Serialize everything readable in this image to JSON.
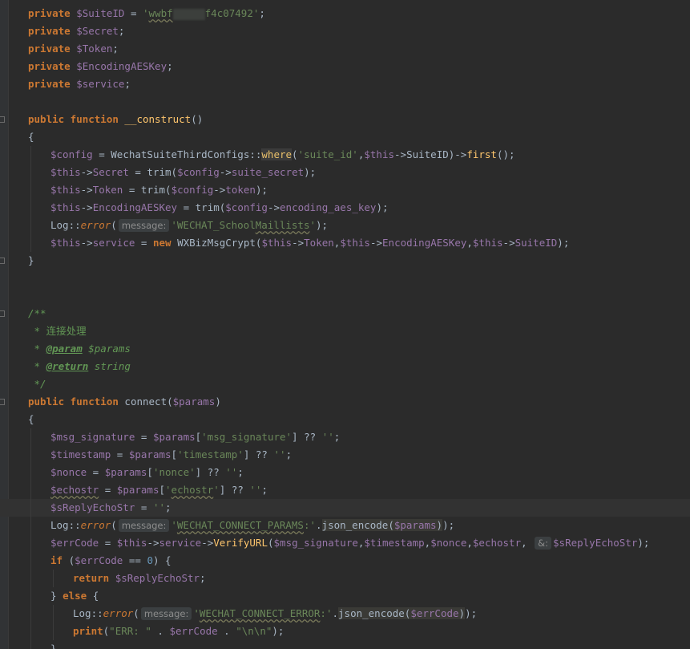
{
  "editor": {
    "lines": [
      {
        "i": 0,
        "indent": 0,
        "tokens": [
          [
            "kw",
            "private"
          ],
          [
            "pl",
            " "
          ],
          [
            "var",
            "$SuiteID"
          ],
          [
            "pl",
            " = "
          ],
          [
            "str",
            "'"
          ],
          [
            "str wavy",
            "wwbf"
          ],
          [
            "blur",
            ""
          ],
          [
            "str",
            "f4c07492"
          ],
          [
            "str",
            "'"
          ],
          [
            "op",
            ";"
          ]
        ]
      },
      {
        "i": 1,
        "indent": 0,
        "tokens": [
          [
            "kw",
            "private"
          ],
          [
            "pl",
            " "
          ],
          [
            "var",
            "$Secret"
          ],
          [
            "op",
            ";"
          ]
        ]
      },
      {
        "i": 2,
        "indent": 0,
        "tokens": [
          [
            "kw",
            "private"
          ],
          [
            "pl",
            " "
          ],
          [
            "var",
            "$Token"
          ],
          [
            "op",
            ";"
          ]
        ]
      },
      {
        "i": 3,
        "indent": 0,
        "tokens": [
          [
            "kw",
            "private"
          ],
          [
            "pl",
            " "
          ],
          [
            "var",
            "$EncodingAESKey"
          ],
          [
            "op",
            ";"
          ]
        ]
      },
      {
        "i": 4,
        "indent": 0,
        "tokens": [
          [
            "kw",
            "private"
          ],
          [
            "pl",
            " "
          ],
          [
            "var",
            "$service"
          ],
          [
            "op",
            ";"
          ]
        ]
      },
      {
        "i": 6,
        "indent": 0,
        "tokens": [
          [
            "kw",
            "public function"
          ],
          [
            "pl",
            " "
          ],
          [
            "fn",
            "__construct"
          ],
          [
            "pl",
            "()"
          ]
        ]
      },
      {
        "i": 7,
        "indent": 0,
        "tokens": [
          [
            "pl",
            "{"
          ]
        ]
      },
      {
        "i": 8,
        "indent": 1,
        "tokens": [
          [
            "var",
            "$config"
          ],
          [
            "pl",
            " = WechatSuiteThirdConfigs::"
          ],
          [
            "hl",
            "where"
          ],
          [
            "pl",
            "("
          ],
          [
            "str",
            "'suite_id'"
          ],
          [
            "pl",
            ","
          ],
          [
            "var",
            "$this"
          ],
          [
            "pl",
            "->SuiteID)->"
          ],
          [
            "fn",
            "first"
          ],
          [
            "pl",
            "();"
          ]
        ]
      },
      {
        "i": 9,
        "indent": 1,
        "tokens": [
          [
            "var",
            "$this"
          ],
          [
            "pl",
            "->"
          ],
          [
            "var",
            "Secret"
          ],
          [
            "pl",
            " = trim("
          ],
          [
            "var",
            "$config"
          ],
          [
            "pl",
            "->"
          ],
          [
            "var",
            "suite_secret"
          ],
          [
            "pl",
            ");"
          ]
        ]
      },
      {
        "i": 10,
        "indent": 1,
        "tokens": [
          [
            "var",
            "$this"
          ],
          [
            "pl",
            "->"
          ],
          [
            "var",
            "Token"
          ],
          [
            "pl",
            " = trim("
          ],
          [
            "var",
            "$config"
          ],
          [
            "pl",
            "->"
          ],
          [
            "var",
            "token"
          ],
          [
            "pl",
            ");"
          ]
        ]
      },
      {
        "i": 11,
        "indent": 1,
        "tokens": [
          [
            "var",
            "$this"
          ],
          [
            "pl",
            "->"
          ],
          [
            "var",
            "EncodingAESKey"
          ],
          [
            "pl",
            " = trim("
          ],
          [
            "var",
            "$config"
          ],
          [
            "pl",
            "->"
          ],
          [
            "var",
            "encoding_aes_key"
          ],
          [
            "pl",
            ");"
          ]
        ]
      },
      {
        "i": 12,
        "indent": 1,
        "tokens": [
          [
            "pl",
            "Log::"
          ],
          [
            "it",
            "error"
          ],
          [
            "pl",
            "("
          ],
          [
            "hint",
            "message:"
          ],
          [
            "str",
            "'WECHAT_School"
          ],
          [
            "str wavy",
            "Maillists"
          ],
          [
            "str",
            "'"
          ],
          [
            "pl",
            ");"
          ]
        ]
      },
      {
        "i": 13,
        "indent": 1,
        "tokens": [
          [
            "var",
            "$this"
          ],
          [
            "pl",
            "->"
          ],
          [
            "var",
            "service"
          ],
          [
            "pl",
            " = "
          ],
          [
            "kw",
            "new"
          ],
          [
            "pl",
            " WXBizMsgCrypt("
          ],
          [
            "var",
            "$this"
          ],
          [
            "pl",
            "->"
          ],
          [
            "var",
            "Token"
          ],
          [
            "pl",
            ","
          ],
          [
            "var",
            "$this"
          ],
          [
            "pl",
            "->"
          ],
          [
            "var",
            "EncodingAESKey"
          ],
          [
            "pl",
            ","
          ],
          [
            "var",
            "$this"
          ],
          [
            "pl",
            "->"
          ],
          [
            "var",
            "SuiteID"
          ],
          [
            "pl",
            ");"
          ]
        ]
      },
      {
        "i": 14,
        "indent": 0,
        "tokens": [
          [
            "pl",
            "}"
          ]
        ]
      },
      {
        "i": 17,
        "indent": 0,
        "tokens": [
          [
            "cmi",
            "/**"
          ]
        ]
      },
      {
        "i": 18,
        "indent": 0,
        "tokens": [
          [
            "cmi",
            " * "
          ],
          [
            "cjk",
            "连接处理"
          ]
        ]
      },
      {
        "i": 19,
        "indent": 0,
        "tokens": [
          [
            "cmi",
            " * "
          ],
          [
            "tag",
            "@param"
          ],
          [
            "cmi",
            " $params"
          ]
        ]
      },
      {
        "i": 20,
        "indent": 0,
        "tokens": [
          [
            "cmi",
            " * "
          ],
          [
            "tag",
            "@return"
          ],
          [
            "cmi",
            " string"
          ]
        ]
      },
      {
        "i": 21,
        "indent": 0,
        "tokens": [
          [
            "cmi",
            " */"
          ]
        ]
      },
      {
        "i": 22,
        "indent": 0,
        "tokens": [
          [
            "kw",
            "public function"
          ],
          [
            "pl",
            " connect("
          ],
          [
            "var",
            "$params"
          ],
          [
            "pl",
            ")"
          ]
        ]
      },
      {
        "i": 23,
        "indent": 0,
        "tokens": [
          [
            "pl",
            "{"
          ]
        ]
      },
      {
        "i": 24,
        "indent": 1,
        "tokens": [
          [
            "var",
            "$msg_signature"
          ],
          [
            "pl",
            " = "
          ],
          [
            "var",
            "$params"
          ],
          [
            "pl",
            "["
          ],
          [
            "str",
            "'msg_signature'"
          ],
          [
            "pl",
            "] ?? "
          ],
          [
            "str",
            "''"
          ],
          [
            "op",
            ";"
          ]
        ]
      },
      {
        "i": 25,
        "indent": 1,
        "tokens": [
          [
            "var",
            "$timestamp"
          ],
          [
            "pl",
            " = "
          ],
          [
            "var",
            "$params"
          ],
          [
            "pl",
            "["
          ],
          [
            "str",
            "'timestamp'"
          ],
          [
            "pl",
            "] ?? "
          ],
          [
            "str",
            "''"
          ],
          [
            "op",
            ";"
          ]
        ]
      },
      {
        "i": 26,
        "indent": 1,
        "tokens": [
          [
            "var",
            "$nonce"
          ],
          [
            "pl",
            " = "
          ],
          [
            "var",
            "$params"
          ],
          [
            "pl",
            "["
          ],
          [
            "str",
            "'nonce'"
          ],
          [
            "pl",
            "] ?? "
          ],
          [
            "str",
            "''"
          ],
          [
            "op",
            ";"
          ]
        ]
      },
      {
        "i": 27,
        "indent": 1,
        "tokens": [
          [
            "var wavy",
            "$echostr"
          ],
          [
            "pl",
            " = "
          ],
          [
            "var",
            "$params"
          ],
          [
            "pl",
            "["
          ],
          [
            "str",
            "'"
          ],
          [
            "str wavy",
            "echostr"
          ],
          [
            "str",
            "'"
          ],
          [
            "pl",
            "] ?? "
          ],
          [
            "str",
            "''"
          ],
          [
            "op",
            ";"
          ]
        ]
      },
      {
        "i": 28,
        "indent": 1,
        "current": true,
        "tokens": [
          [
            "var",
            "$sReplyEchoStr"
          ],
          [
            "pl",
            " = "
          ],
          [
            "str",
            "''"
          ],
          [
            "op",
            ";"
          ]
        ]
      },
      {
        "i": 29,
        "indent": 1,
        "tokens": [
          [
            "pl",
            "Log::"
          ],
          [
            "it",
            "error"
          ],
          [
            "pl",
            "("
          ],
          [
            "hint",
            "message:"
          ],
          [
            "str",
            "'"
          ],
          [
            "str wavy",
            "WECHAT_CONNECT_PARAMS"
          ],
          [
            "str",
            ":'"
          ],
          [
            "pl",
            "."
          ],
          [
            "hlbox",
            "json_encode("
          ],
          [
            "var hlbox",
            "$params"
          ],
          [
            "hlbox",
            ")"
          ],
          [
            "pl",
            ");"
          ]
        ]
      },
      {
        "i": 30,
        "indent": 1,
        "tokens": [
          [
            "var",
            "$errCode"
          ],
          [
            "pl",
            " = "
          ],
          [
            "var",
            "$this"
          ],
          [
            "pl",
            "->"
          ],
          [
            "var",
            "service"
          ],
          [
            "pl",
            "->"
          ],
          [
            "fn",
            "VerifyURL"
          ],
          [
            "pl",
            "("
          ],
          [
            "var",
            "$msg_signature"
          ],
          [
            "pl",
            ","
          ],
          [
            "var",
            "$timestamp"
          ],
          [
            "pl",
            ","
          ],
          [
            "var",
            "$nonce"
          ],
          [
            "pl",
            ","
          ],
          [
            "var",
            "$echostr"
          ],
          [
            "pl",
            ", "
          ],
          [
            "hint",
            "&:"
          ],
          [
            "var",
            "$sReplyEchoStr"
          ],
          [
            "pl",
            ");"
          ]
        ]
      },
      {
        "i": 31,
        "indent": 1,
        "tokens": [
          [
            "kw",
            "if"
          ],
          [
            "pl",
            " ("
          ],
          [
            "var",
            "$errCode"
          ],
          [
            "pl",
            " == "
          ],
          [
            "num",
            "0"
          ],
          [
            "pl",
            ") {"
          ]
        ]
      },
      {
        "i": 32,
        "indent": 2,
        "tokens": [
          [
            "kw",
            "return"
          ],
          [
            "pl",
            " "
          ],
          [
            "var",
            "$sReplyEchoStr"
          ],
          [
            "op",
            ";"
          ]
        ]
      },
      {
        "i": 33,
        "indent": 1,
        "tokens": [
          [
            "pl",
            "} "
          ],
          [
            "kw",
            "else"
          ],
          [
            "pl",
            " {"
          ]
        ]
      },
      {
        "i": 34,
        "indent": 2,
        "tokens": [
          [
            "pl",
            "Log::"
          ],
          [
            "it",
            "error"
          ],
          [
            "pl",
            "("
          ],
          [
            "hint",
            "message:"
          ],
          [
            "str",
            "'"
          ],
          [
            "str wavy",
            "WECHAT_CONNECT_ERROR"
          ],
          [
            "str",
            ":'"
          ],
          [
            "pl",
            "."
          ],
          [
            "hlbox",
            "json_encode("
          ],
          [
            "var hlbox",
            "$errCode"
          ],
          [
            "hlbox",
            ")"
          ],
          [
            "pl",
            ");"
          ]
        ]
      },
      {
        "i": 35,
        "indent": 2,
        "tokens": [
          [
            "kw",
            "print"
          ],
          [
            "pl",
            "("
          ],
          [
            "str",
            "\"ERR: \""
          ],
          [
            "pl",
            " . "
          ],
          [
            "var",
            "$errCode"
          ],
          [
            "pl",
            " . "
          ],
          [
            "str",
            "\"\\n\\n\""
          ],
          [
            "pl",
            ");"
          ]
        ]
      },
      {
        "i": 36,
        "indent": 1,
        "tokens": [
          [
            "pl",
            "}"
          ]
        ]
      }
    ],
    "folds": [
      6,
      14,
      17,
      22
    ]
  }
}
